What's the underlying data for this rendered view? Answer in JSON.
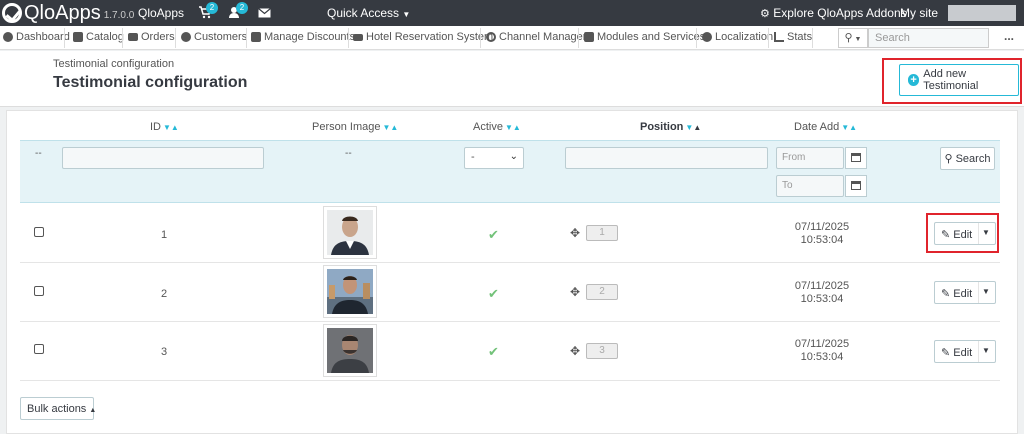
{
  "header": {
    "brand": "QloApps",
    "version": "1.7.0.0",
    "shop_name": "QloApps",
    "orders_badge": "2",
    "customers_badge": "2",
    "quick_access": "Quick Access",
    "explore": "Explore QloApps Addons",
    "my_site": "My site"
  },
  "nav": {
    "items": [
      {
        "label": "Dashboard",
        "icon": "dashboard-icon"
      },
      {
        "label": "Catalog",
        "icon": "book-icon"
      },
      {
        "label": "Orders",
        "icon": "credit-card-icon"
      },
      {
        "label": "Customers",
        "icon": "users-icon"
      },
      {
        "label": "Manage Discounts",
        "icon": "tag-icon"
      },
      {
        "label": "Hotel Reservation System",
        "icon": "bed-icon"
      },
      {
        "label": "Channel Manager",
        "icon": "refresh-icon"
      },
      {
        "label": "Modules and Services",
        "icon": "puzzle-icon"
      },
      {
        "label": "Localization",
        "icon": "globe-icon"
      },
      {
        "label": "Stats",
        "icon": "bar-chart-icon"
      }
    ],
    "search_placeholder": "Search",
    "more": "..."
  },
  "page": {
    "breadcrumb": "Testimonial configuration",
    "title": "Testimonial configuration",
    "add_button": "Add new Testimonial"
  },
  "table": {
    "columns": {
      "id": "ID",
      "image": "Person Image",
      "active": "Active",
      "position": "Position",
      "date_add": "Date Add"
    },
    "filters": {
      "dash": "--",
      "active_selected": "-",
      "date_from": "From",
      "date_to": "To",
      "search": "Search"
    },
    "rows": [
      {
        "id": "1",
        "active": "✔",
        "position": "1",
        "date": "07/11/2025",
        "time": "10:53:04",
        "edit": "Edit"
      },
      {
        "id": "2",
        "active": "✔",
        "position": "2",
        "date": "07/11/2025",
        "time": "10:53:04",
        "edit": "Edit"
      },
      {
        "id": "3",
        "active": "✔",
        "position": "3",
        "date": "07/11/2025",
        "time": "10:53:04",
        "edit": "Edit"
      }
    ],
    "bulk_actions": "Bulk actions"
  },
  "colors": {
    "topbar": "#363a41",
    "accent": "#25b9d7",
    "highlight": "#e0242c",
    "active_check": "#72c279"
  }
}
